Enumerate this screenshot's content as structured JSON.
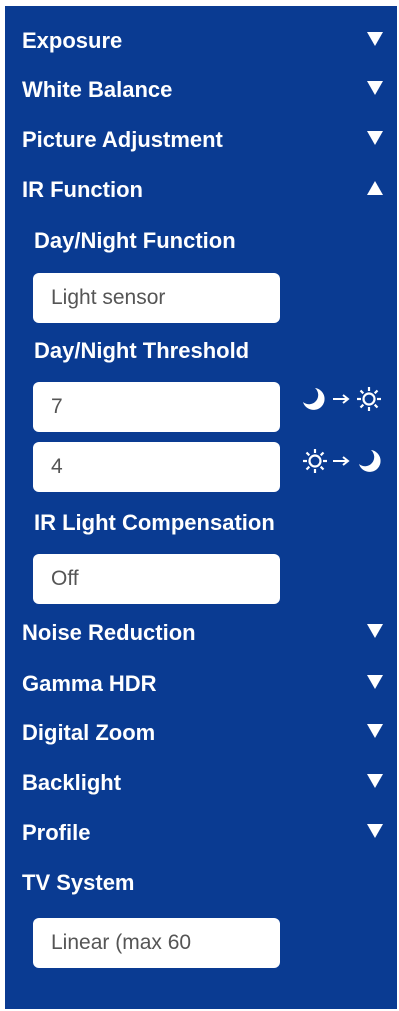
{
  "sections": {
    "exposure": "Exposure",
    "white_balance": "White Balance",
    "picture_adjustment": "Picture Adjustment",
    "ir_function": "IR Function",
    "noise_reduction": "Noise Reduction",
    "gamma_hdr": "Gamma HDR",
    "digital_zoom": "Digital Zoom",
    "backlight": "Backlight",
    "profile": "Profile",
    "tv_system": "TV System"
  },
  "ir_function": {
    "day_night_function_label": "Day/Night Function",
    "day_night_function_value": "Light sensor",
    "day_night_threshold_label": "Day/Night Threshold",
    "threshold_night_to_day_value": "7",
    "threshold_day_to_night_value": "4",
    "ir_light_compensation_label": "IR Light Compensation",
    "ir_light_compensation_value": "Off"
  },
  "tv_system_value": "Linear (max 60",
  "icons": {
    "collapsed": "triangle-down-icon",
    "expanded": "triangle-up-icon",
    "night_to_day": "moon-to-sun-icon",
    "day_to_night": "sun-to-moon-icon"
  },
  "colors": {
    "panel_background": "#0a3b92",
    "text": "#ffffff",
    "field_background": "#ffffff",
    "field_text": "#555555"
  }
}
